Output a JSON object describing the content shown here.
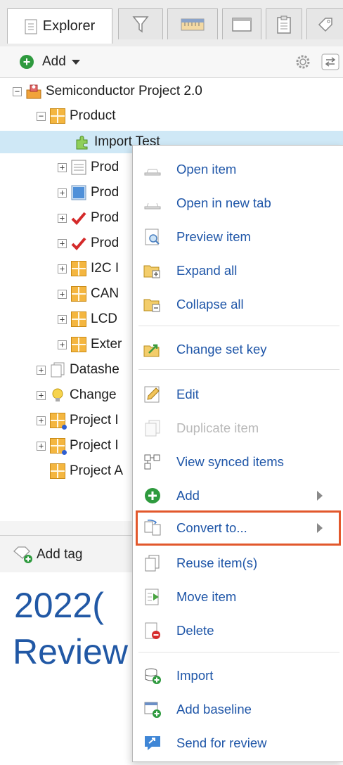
{
  "tabs": [
    {
      "label": "Explorer",
      "icon": "explorer-icon"
    },
    {
      "label": "",
      "icon": "filter-icon"
    },
    {
      "label": "",
      "icon": "ruler-icon"
    },
    {
      "label": "",
      "icon": "window-icon"
    },
    {
      "label": "",
      "icon": "clipboard-icon"
    },
    {
      "label": "",
      "icon": "tag-icon"
    }
  ],
  "toolbar": {
    "add_label": "Add"
  },
  "tree": {
    "root": "Semiconductor Project 2.0",
    "product": "Product",
    "selected": "Import Test",
    "children": [
      "Prod",
      "Prod",
      "Prod",
      "Prod",
      "I2C I",
      "CAN",
      "LCD",
      "Exter"
    ],
    "siblings": [
      "Datashe",
      "Change",
      "Project I",
      "Project I",
      "Project A"
    ]
  },
  "tagbar": {
    "add_tag_label": "Add tag"
  },
  "content": {
    "line1": "2022(",
    "line2": "Review"
  },
  "menu": {
    "items": [
      {
        "label": "Open item",
        "icon": "open-item-icon"
      },
      {
        "label": "Open in new tab",
        "icon": "open-new-tab-icon"
      },
      {
        "label": "Preview item",
        "icon": "preview-icon"
      },
      {
        "label": "Expand all",
        "icon": "expand-all-icon"
      },
      {
        "label": "Collapse all",
        "icon": "collapse-all-icon"
      },
      {
        "label": "Change set key",
        "icon": "change-set-key-icon"
      },
      {
        "label": "Edit",
        "icon": "pencil-icon"
      },
      {
        "label": "Duplicate item",
        "icon": "duplicate-icon",
        "disabled": true
      },
      {
        "label": "View synced items",
        "icon": "synced-items-icon"
      },
      {
        "label": "Add",
        "icon": "add-icon",
        "submenu": true
      },
      {
        "label": "Convert to...",
        "icon": "convert-icon",
        "submenu": true,
        "highlighted": true
      },
      {
        "label": "Reuse item(s)",
        "icon": "reuse-icon"
      },
      {
        "label": "Move item",
        "icon": "move-icon"
      },
      {
        "label": "Delete",
        "icon": "delete-icon"
      },
      {
        "label": "Import",
        "icon": "import-icon"
      },
      {
        "label": "Add baseline",
        "icon": "baseline-icon"
      },
      {
        "label": "Send for review",
        "icon": "review-icon"
      }
    ]
  },
  "colors": {
    "menu_text": "#1f56a8",
    "highlight": "#e2582c",
    "selection": "#cfe8f6",
    "add_green": "#2e9a3e"
  }
}
